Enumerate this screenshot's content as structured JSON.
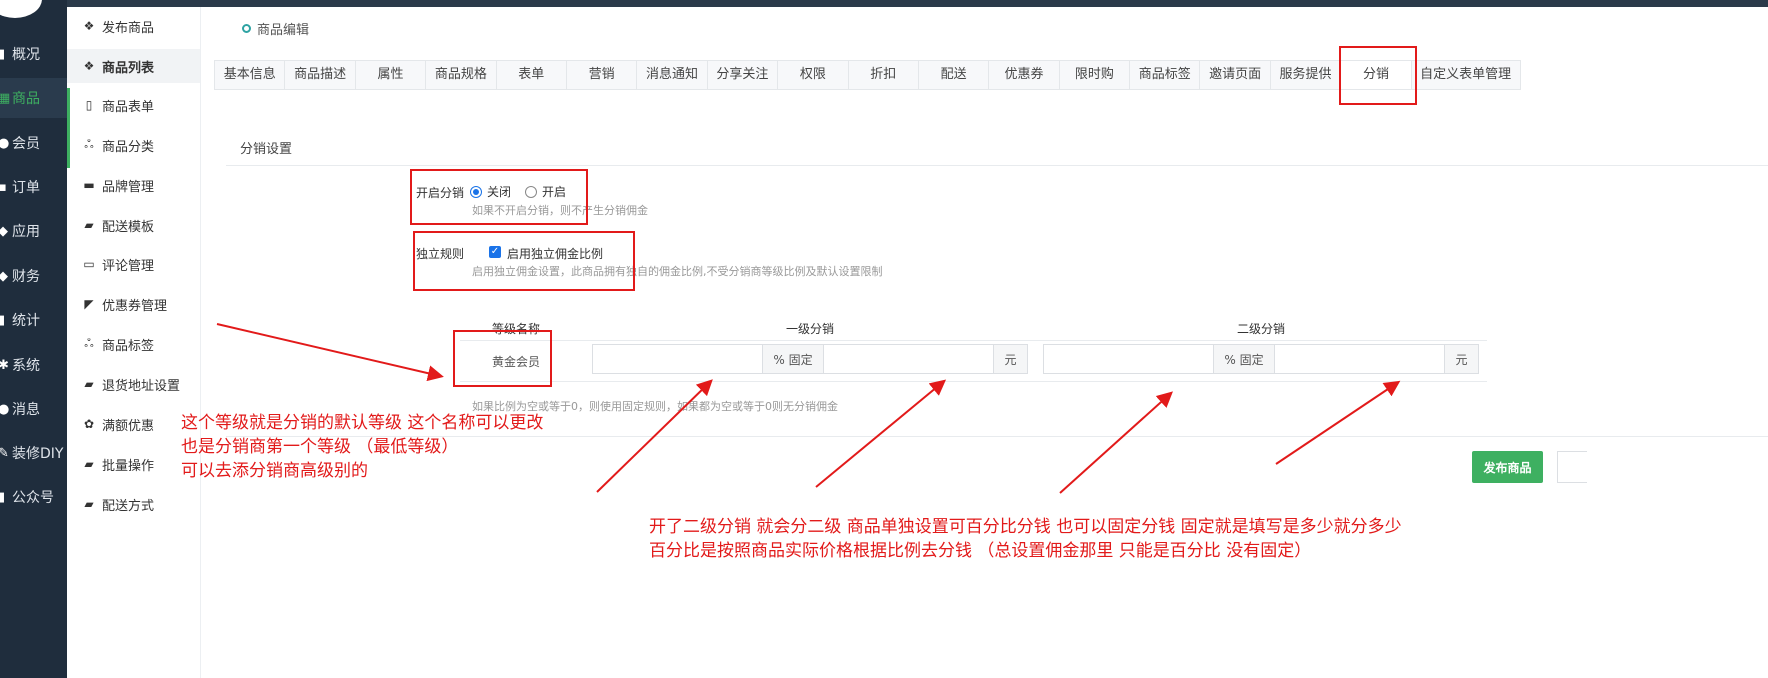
{
  "nav": {
    "items": [
      {
        "label": "概况",
        "icon": "document-icon"
      },
      {
        "label": "商品",
        "icon": "goods-icon",
        "active": true
      },
      {
        "label": "会员",
        "icon": "users-icon"
      },
      {
        "label": "订单",
        "icon": "cart-icon"
      },
      {
        "label": "应用",
        "icon": "apps-icon"
      },
      {
        "label": "财务",
        "icon": "money-icon"
      },
      {
        "label": "统计",
        "icon": "chart-icon"
      },
      {
        "label": "系统",
        "icon": "gear-icon"
      },
      {
        "label": "消息",
        "icon": "message-icon"
      },
      {
        "label": "装修DIY",
        "icon": "brush-icon"
      },
      {
        "label": "公众号",
        "icon": "wechat-icon"
      }
    ]
  },
  "submenu": {
    "items": [
      {
        "label": "发布商品",
        "icon": "cubes-icon"
      },
      {
        "label": "商品列表",
        "icon": "cubes-icon",
        "active": true
      },
      {
        "label": "商品表单",
        "icon": "file-icon"
      },
      {
        "label": "商品分类",
        "icon": "sitemap-icon"
      },
      {
        "label": "品牌管理",
        "icon": "briefcase-icon"
      },
      {
        "label": "配送模板",
        "icon": "truck-icon"
      },
      {
        "label": "评论管理",
        "icon": "comment-icon"
      },
      {
        "label": "优惠券管理",
        "icon": "tag-icon"
      },
      {
        "label": "商品标签",
        "icon": "sitemap-icon"
      },
      {
        "label": "退货地址设置",
        "icon": "truck-icon"
      },
      {
        "label": "满额优惠",
        "icon": "gift-icon"
      },
      {
        "label": "批量操作",
        "icon": "truck-icon"
      },
      {
        "label": "配送方式",
        "icon": "truck-icon"
      }
    ]
  },
  "breadcrumb": "商品编辑",
  "tabs": [
    "基本信息",
    "商品描述",
    "属性",
    "商品规格",
    "表单",
    "营销",
    "消息通知",
    "分享关注",
    "权限",
    "折扣",
    "配送",
    "优惠券",
    "限时购",
    "商品标签",
    "邀请页面",
    "服务提供",
    "分销",
    "自定义表单管理"
  ],
  "active_tab": "分销",
  "section_title": "分销设置",
  "form": {
    "enable_label": "开启分销",
    "radio_off": "关闭",
    "radio_on": "开启",
    "enable_help": "如果不开启分销，则不产生分销佣金",
    "rule_label": "独立规则",
    "rule_checkbox": "启用独立佣金比例",
    "rule_help": "启用独立佣金设置，此商品拥有独自的佣金比例,不受分销商等级比例及默认设置限制"
  },
  "table": {
    "col_level": "等级名称",
    "col_first": "一级分销",
    "col_second": "二级分销",
    "row_level": "黄金会员",
    "addon_percent": "% 固定",
    "addon_yuan": "元",
    "help": "如果比例为空或等于0，则使用固定规则，如果都为空或等于0则无分销佣金"
  },
  "publish_button": "发布商品",
  "annotations": {
    "note_left": [
      "这个等级就是分销的默认等级 这个名称可以更改",
      "也是分销商第一个等级 （最低等级）",
      "可以去添分销商高级别的"
    ],
    "note_bottom": [
      "开了二级分销  就会分二级    商品单独设置可百分比分钱 也可以固定分钱       固定就是填写是多少就分多少",
      "百分比是按照商品实际价格根据比例去分钱     （总设置佣金那里 只能是百分比 没有固定）"
    ]
  },
  "colors": {
    "annotation": "#e21a1a",
    "accent": "#3eb061",
    "nav_bg": "#1f2d3d",
    "checkbox": "#1a73e8"
  }
}
